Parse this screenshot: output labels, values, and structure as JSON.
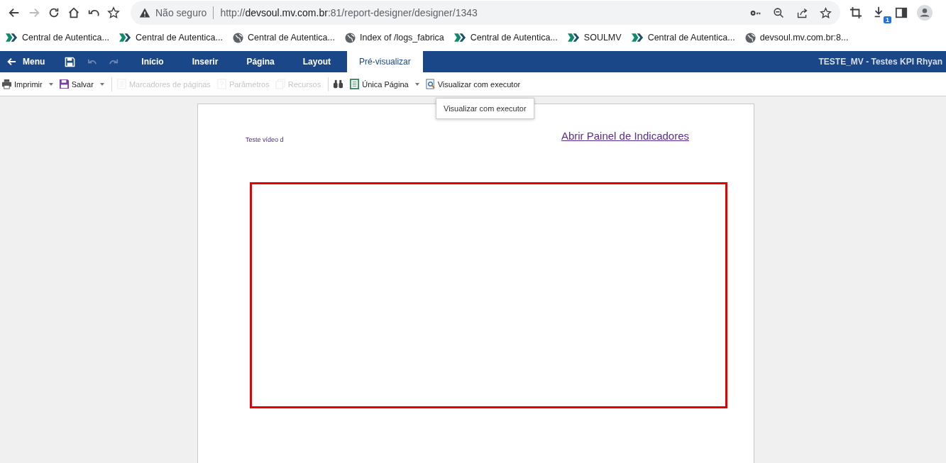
{
  "browser": {
    "security_label": "Não seguro",
    "url_scheme": "http://",
    "url_host": "devsoul.mv.com.br",
    "url_path": ":81/report-designer/designer/1343",
    "downloads_badge": "1"
  },
  "bookmarks": [
    {
      "label": "Central de Autentica...",
      "kind": "mv"
    },
    {
      "label": "Central de Autentica...",
      "kind": "mv"
    },
    {
      "label": "Central de Autentica...",
      "kind": "globe"
    },
    {
      "label": "Index of /logs_fabrica",
      "kind": "globe"
    },
    {
      "label": "Central de Autentica...",
      "kind": "mv"
    },
    {
      "label": "SOULMV",
      "kind": "mv"
    },
    {
      "label": "Central de Autentica...",
      "kind": "mv"
    },
    {
      "label": "devsoul.mv.com.br:8...",
      "kind": "globe"
    }
  ],
  "app": {
    "menu_label": "Menu",
    "title": "TESTE_MV - Testes KPI Rhyan",
    "tabs": [
      {
        "label": "Início",
        "selected": false
      },
      {
        "label": "Inserir",
        "selected": false
      },
      {
        "label": "Página",
        "selected": false
      },
      {
        "label": "Layout",
        "selected": false
      },
      {
        "label": "Pré-visualizar",
        "selected": true
      }
    ]
  },
  "toolbar": [
    {
      "kind": "print",
      "label": "Imprimir",
      "dropdown": true,
      "disabled": false
    },
    {
      "kind": "save",
      "label": "Salvar",
      "dropdown": true,
      "disabled": false
    },
    {
      "kind": "separator"
    },
    {
      "kind": "bookmarks",
      "label": "Marcadores de páginas",
      "dropdown": false,
      "disabled": true
    },
    {
      "kind": "params",
      "label": "Parâmetros",
      "dropdown": false,
      "disabled": true
    },
    {
      "kind": "resources",
      "label": "Recursos",
      "dropdown": false,
      "disabled": true
    },
    {
      "kind": "separator"
    },
    {
      "kind": "find",
      "dropdown": false,
      "disabled": false
    },
    {
      "kind": "page",
      "label": "Única Página",
      "dropdown": true,
      "disabled": false
    },
    {
      "kind": "preview",
      "label": "Visualizar com executor",
      "dropdown": false,
      "disabled": false
    }
  ],
  "tooltip": "Visualizar com executor",
  "report": {
    "text": "Teste vídeo d",
    "link": "Abrir Painel de Indicadores"
  }
}
